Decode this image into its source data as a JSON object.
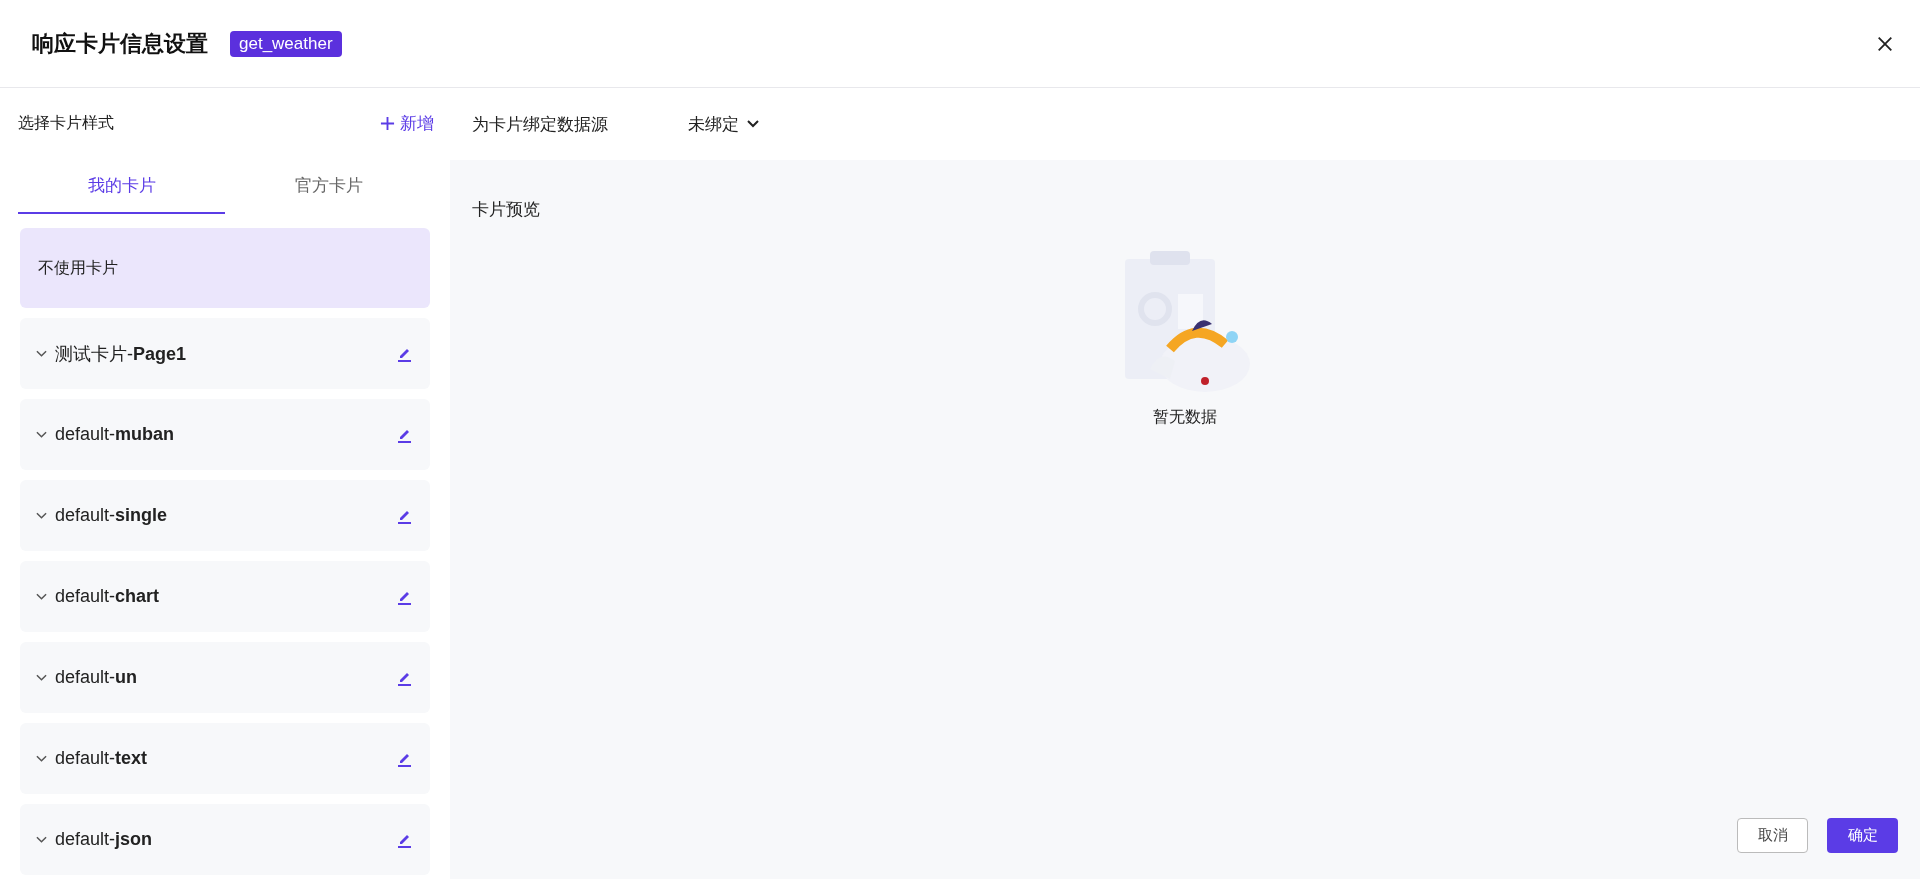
{
  "dialog": {
    "title": "响应卡片信息设置",
    "badge": "get_weather"
  },
  "left_panel": {
    "heading": "选择卡片样式",
    "add_button": "新增",
    "tabs": [
      {
        "label": "我的卡片",
        "selected": true
      },
      {
        "label": "官方卡片",
        "selected": false
      }
    ],
    "cards": [
      {
        "kind": "plain",
        "name": "不使用卡片",
        "selected": true
      },
      {
        "kind": "template",
        "name": "测试卡片-**Page1**",
        "selected": false,
        "expanded": false
      },
      {
        "kind": "template",
        "name": "default-**muban**",
        "selected": false,
        "expanded": false
      },
      {
        "kind": "template",
        "name": "default-**single**",
        "selected": false,
        "expanded": false
      },
      {
        "kind": "template",
        "name": "default-**chart**",
        "selected": false,
        "expanded": false
      },
      {
        "kind": "template",
        "name": "default-**un**",
        "selected": false,
        "expanded": false
      },
      {
        "kind": "template",
        "name": "default-**text**",
        "selected": false,
        "expanded": false
      },
      {
        "kind": "template",
        "name": "default-**json**",
        "selected": false,
        "expanded": false
      }
    ]
  },
  "right_panel": {
    "bind_label": "为卡片绑定数据源",
    "bind_value": "未绑定",
    "preview_title": "卡片预览",
    "empty_text": "暂无数据"
  },
  "buttons": [
    {
      "kind": "secondary",
      "label": "取消"
    },
    {
      "kind": "primary",
      "label": "确定"
    }
  ]
}
